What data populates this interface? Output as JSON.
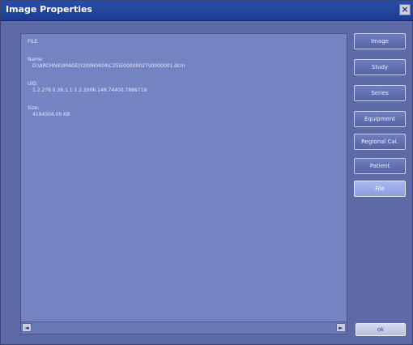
{
  "window": {
    "title": "Image Properties",
    "close_icon": "×"
  },
  "content": {
    "section_file": "FILE",
    "name_label": "Name:",
    "name_value": "D:\\ARCHIVE\\IMAGE\\Y20060404\\C25\\E00000027\\I0000001.dcm",
    "uid_label": "UID:",
    "uid_value": "1.2.276.0.26.1.1.1.2.2006.149.74400.7886719",
    "size_label": "Size:",
    "size_value": "4194304.00 KB"
  },
  "buttons": {
    "image": "Image",
    "study": "Study",
    "series": "Series",
    "equipment": "Equipment",
    "regional_cal": "Regional Cal.",
    "patient": "Patient",
    "file": "File",
    "ok": "ok"
  },
  "scrollbar": {
    "left_icon": "◄",
    "right_icon": "►"
  }
}
